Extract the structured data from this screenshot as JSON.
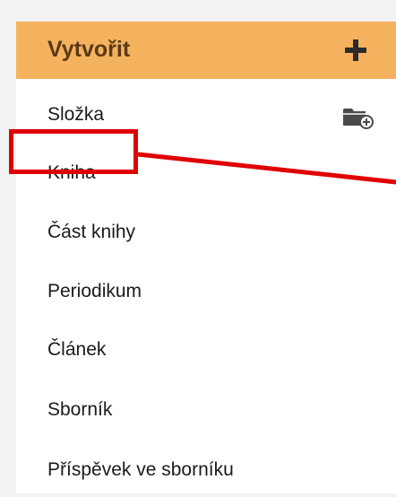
{
  "menu": {
    "header": {
      "title": "Vytvořit",
      "action_icon": "plus-icon"
    },
    "items": [
      {
        "label": "Složka",
        "icon": "folder-plus-icon"
      },
      {
        "label": "Kniha"
      },
      {
        "label": "Část knihy"
      },
      {
        "label": "Periodikum"
      },
      {
        "label": "Článek"
      },
      {
        "label": "Sborník"
      },
      {
        "label": "Příspěvek ve sborníku"
      }
    ]
  },
  "annotation": {
    "highlighted_item": "Kniha",
    "color": "#e00000"
  },
  "colors": {
    "header_bg": "#f5b25e",
    "header_text": "#5a3a17",
    "page_bg": "#f2f2f2"
  }
}
